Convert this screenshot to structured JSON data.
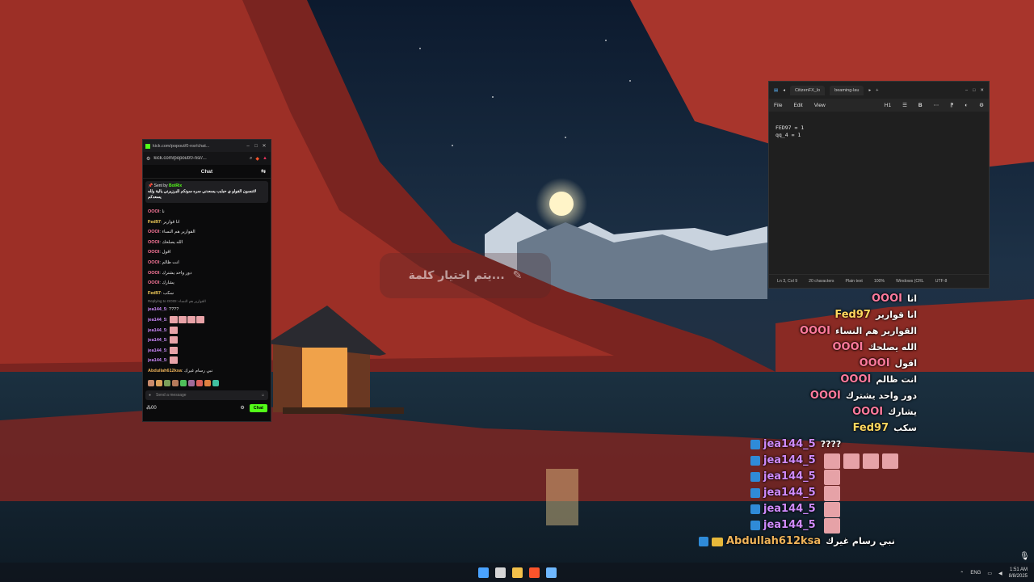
{
  "ime_toast": {
    "text": "يتم اختيار كلمة...",
    "icon": "pencil-icon"
  },
  "chat_window": {
    "tab_title": "kick.com/popout/0-nsr/chat...",
    "url": "kick.com/popout/0-nsr/...",
    "header_title": "Chat",
    "pinned": {
      "sent_by_label": "Sent by",
      "sender": "BotRix",
      "message": "لاتنسون الفولو ي حبايب يسعدني سره سونكم للبرزيرني يالية ولله يسعدكم"
    },
    "messages": [
      {
        "user": "OOOI",
        "user_class": "u-oool",
        "text": "نا"
      },
      {
        "user": "Fed97",
        "user_class": "u-fed",
        "text": "انا قوارير"
      },
      {
        "user": "OOOI",
        "user_class": "u-oool",
        "text": "القوارير هم النساء"
      },
      {
        "user": "OOOI",
        "user_class": "u-oool",
        "text": "الله يصلحك"
      },
      {
        "user": "OOOI",
        "user_class": "u-oool",
        "text": "اقول"
      },
      {
        "user": "OOOI",
        "user_class": "u-oool",
        "text": "انت ظالم"
      },
      {
        "user": "OOOI",
        "user_class": "u-oool",
        "text": "دور واحد يشترك"
      },
      {
        "user": "OOOI",
        "user_class": "u-oool",
        "text": "يشارك"
      },
      {
        "user": "Fed97",
        "user_class": "u-fed",
        "text": "سكب"
      }
    ],
    "reply_note": "Replying to OOOI: القوارير هم النساء",
    "jea_messages": [
      {
        "user": "jea144_5",
        "text": "????",
        "emotes": 0
      },
      {
        "user": "jea144_5",
        "text": "",
        "emotes": 4
      },
      {
        "user": "jea144_5",
        "text": "",
        "emotes": 1
      },
      {
        "user": "jea144_5",
        "text": "",
        "emotes": 1
      },
      {
        "user": "jea144_5",
        "text": "",
        "emotes": 1
      },
      {
        "user": "jea144_5",
        "text": "",
        "emotes": 1
      }
    ],
    "last_message": {
      "user": "Abdullah612ksa",
      "text": "نبي رسام غيرك"
    },
    "input_placeholder": "Send a message",
    "footer_count": "00",
    "chat_button": "Chat"
  },
  "notepad": {
    "tabs": [
      "CitizenFX_lo",
      "beaming-lau"
    ],
    "menu": [
      "File",
      "Edit",
      "View"
    ],
    "heading_label": "H1",
    "text": "FED97 = 1\nqq_4 = 1",
    "status": [
      "Ln 3, Col 9",
      "20 characters",
      "Plain text",
      "100%",
      "Windows (CRL",
      "UTF-8"
    ]
  },
  "overlay_chat": [
    {
      "user": "OOOI",
      "color": "#ff7a9d",
      "text": "انا",
      "badge": "",
      "emotes": 0
    },
    {
      "user": "Fed97",
      "color": "#ffd75e",
      "text": "انا قوارير",
      "badge": "",
      "emotes": 0
    },
    {
      "user": "OOOI",
      "color": "#ff7a9d",
      "text": "القوارير هم النساء",
      "badge": "",
      "emotes": 0
    },
    {
      "user": "OOOI",
      "color": "#ff7a9d",
      "text": "الله يصلحك",
      "badge": "",
      "emotes": 0
    },
    {
      "user": "OOOI",
      "color": "#ff7a9d",
      "text": "اقول",
      "badge": "",
      "emotes": 0
    },
    {
      "user": "OOOI",
      "color": "#ff7a9d",
      "text": "انت ظالم",
      "badge": "",
      "emotes": 0
    },
    {
      "user": "OOOI",
      "color": "#ff7a9d",
      "text": "دور واحد يشترك",
      "badge": "",
      "emotes": 0
    },
    {
      "user": "OOOI",
      "color": "#ff7a9d",
      "text": "يشارك",
      "badge": "",
      "emotes": 0
    },
    {
      "user": "Fed97",
      "color": "#ffd75e",
      "text": "سكب",
      "badge": "",
      "emotes": 0
    },
    {
      "user": "jea144_5",
      "color": "#d08bff",
      "text": "????",
      "badge": "sub",
      "emotes": 0
    },
    {
      "user": "jea144_5",
      "color": "#d08bff",
      "text": "",
      "badge": "sub",
      "emotes": 4
    },
    {
      "user": "jea144_5",
      "color": "#d08bff",
      "text": "",
      "badge": "sub",
      "emotes": 1
    },
    {
      "user": "jea144_5",
      "color": "#d08bff",
      "text": "",
      "badge": "sub",
      "emotes": 1
    },
    {
      "user": "jea144_5",
      "color": "#d08bff",
      "text": "",
      "badge": "sub",
      "emotes": 1
    },
    {
      "user": "jea144_5",
      "color": "#d08bff",
      "text": "",
      "badge": "sub",
      "emotes": 1
    },
    {
      "user": "Abdullah612ksa",
      "color": "#f0b45a",
      "text": "نبي رسام غيرك",
      "badge": "crown",
      "emotes": 0
    }
  ],
  "taskbar": {
    "apps": [
      "windows-start-icon",
      "file-explorer-icon",
      "folder-icon",
      "brave-browser-icon",
      "notepad-icon"
    ],
    "language": "ENG",
    "time": "1:51 AM",
    "date": "8/8/2025"
  },
  "colors": {
    "kick_green": "#53fc18",
    "overlay_pink": "#ff7a9d",
    "overlay_gold": "#ffd75e",
    "overlay_purple": "#d08bff"
  }
}
